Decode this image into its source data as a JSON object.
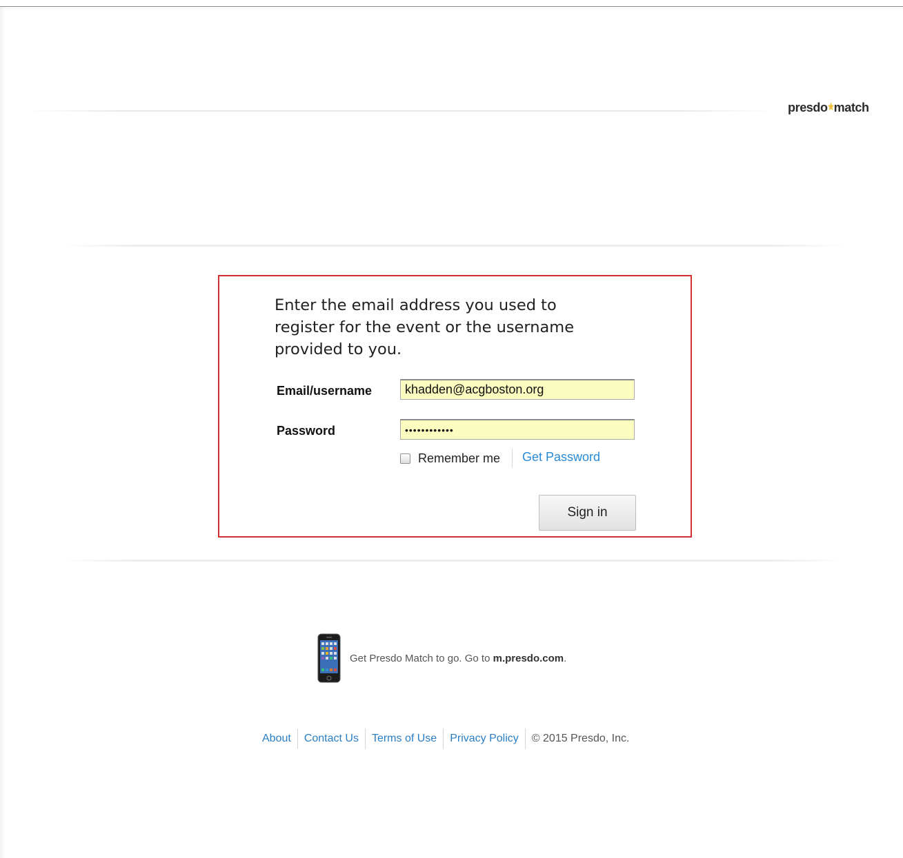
{
  "brand": {
    "logo_text_left": "presdo",
    "logo_text_right": "match",
    "star_color": "#f0c040"
  },
  "login": {
    "intro": "Enter the email address you used to register for the event or the username provided to you.",
    "email_label": "Email/username",
    "email_value": "khadden@acgboston.org",
    "password_label": "Password",
    "password_value": "••••••••••••",
    "remember_label": "Remember me",
    "remember_checked": false,
    "get_password_label": "Get Password",
    "signin_label": "Sign in",
    "highlight_color": "#d22f35",
    "autofill_color": "#fbfcc0"
  },
  "mobile": {
    "text": "Get Presdo Match to go. Go to ",
    "url": "m.presdo.com",
    "suffix": ".",
    "icon": "smartphone-icon"
  },
  "footer": {
    "links": [
      "About",
      "Contact Us",
      "Terms of Use",
      "Privacy Policy"
    ],
    "copyright": "© 2015 Presdo, Inc.",
    "link_color": "#2a7ec4"
  }
}
